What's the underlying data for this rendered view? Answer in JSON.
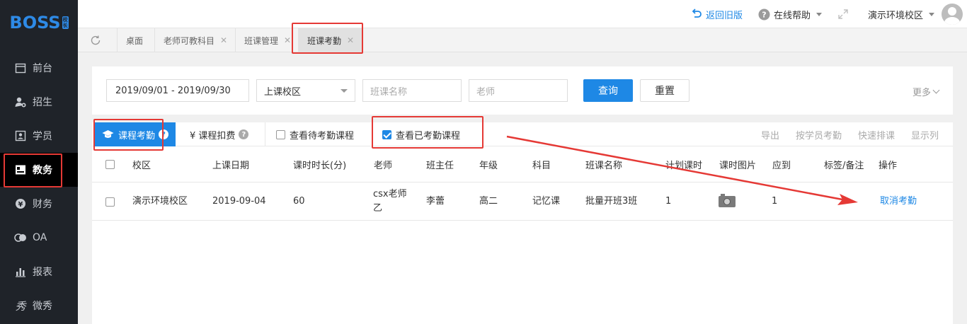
{
  "sidebar": {
    "logo": "BOSS",
    "logo_badge": [
      "校",
      "长"
    ],
    "items": [
      {
        "label": "前台",
        "icon": "calendar-icon"
      },
      {
        "label": "招生",
        "icon": "user-add-icon"
      },
      {
        "label": "学员",
        "icon": "id-card-icon"
      },
      {
        "label": "教务",
        "icon": "image-card-icon",
        "active": true
      },
      {
        "label": "财务",
        "icon": "yen-coin-icon"
      },
      {
        "label": "OA",
        "icon": "toggle-icon"
      },
      {
        "label": "报表",
        "icon": "bar-chart-icon"
      },
      {
        "label": "微秀",
        "icon": "xiu-glyph-icon"
      }
    ]
  },
  "topbar": {
    "back_label": "返回旧版",
    "help_label": "在线帮助",
    "campus_label": "演示环境校区"
  },
  "tabs": [
    {
      "label": "桌面"
    },
    {
      "label": "老师可教科目",
      "closable": true
    },
    {
      "label": "班课管理",
      "closable": true
    },
    {
      "label": "班课考勤",
      "closable": true,
      "active": true
    }
  ],
  "filters": {
    "date_range": "2019/09/01 - 2019/09/30",
    "campus_select": "上课校区",
    "class_name_placeholder": "班课名称",
    "teacher_placeholder": "老师",
    "search_label": "查询",
    "reset_label": "重置",
    "more_label": "更多"
  },
  "subtabs": {
    "attendance_label": "课程考勤",
    "deduct_label": "¥ 课程扣费",
    "pending_label": "查看待考勤课程",
    "pending_checked": false,
    "done_label": "查看已考勤课程",
    "done_checked": true
  },
  "actions": [
    "导出",
    "按学员考勤",
    "快速排课",
    "显示列"
  ],
  "table": {
    "headers": [
      "校区",
      "上课日期",
      "课时时长(分)",
      "老师",
      "班主任",
      "年级",
      "科目",
      "班课名称",
      "计划课时",
      "课时图片",
      "应到",
      "标签/备注",
      "操作"
    ],
    "rows": [
      {
        "campus": "演示环境校区",
        "date": "2019-09-04",
        "duration": "60",
        "teacher": "csx老师乙",
        "head_teacher": "李蕾",
        "grade": "高二",
        "subject": "记忆课",
        "class_name": "批量开班3班",
        "planned": "1",
        "photo_icon": "camera-icon",
        "expected": "1",
        "note": "",
        "action": "取消考勤"
      }
    ]
  },
  "colors": {
    "accent": "#1e88e5",
    "sidebar_bg": "#1f2329",
    "annotation_red": "#e53935"
  }
}
